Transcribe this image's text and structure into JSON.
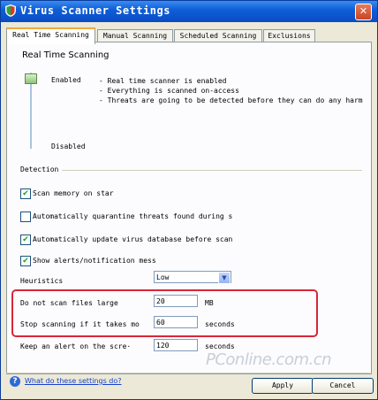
{
  "window": {
    "title": "Virus Scanner Settings"
  },
  "tabs": [
    {
      "label": "Real Time Scanning",
      "active": true
    },
    {
      "label": "Manual Scanning",
      "active": false
    },
    {
      "label": "Scheduled Scanning",
      "active": false
    },
    {
      "label": "Exclusions",
      "active": false
    }
  ],
  "realtime": {
    "heading": "Real Time Scanning",
    "enabled_label": "Enabled",
    "disabled_label": "Disabled",
    "descriptions": [
      "- Real time scanner is enabled",
      "- Everything is scanned on-access",
      "- Threats are going to be detected before they can do any harm"
    ]
  },
  "detection": {
    "label": "Detection",
    "options": [
      {
        "label": "Scan memory on star",
        "checked": true
      },
      {
        "label": "Automatically quarantine threats found during s",
        "checked": false
      },
      {
        "label": "Automatically update virus database before scan",
        "checked": true
      },
      {
        "label": "Show alerts/notification mess",
        "checked": true
      }
    ]
  },
  "heuristics": {
    "label": "Heuristics",
    "value": "Low"
  },
  "limits": {
    "large_files": {
      "label": "Do not scan files large",
      "value": "20",
      "unit": "MB"
    },
    "stop_scanning": {
      "label": "Stop scanning if it takes mo",
      "value": "60",
      "unit": "seconds"
    },
    "alert_screen": {
      "label": "Keep an alert on the scre·",
      "value": "120",
      "unit": "seconds"
    }
  },
  "footer": {
    "help_link": "What do these settings do?",
    "apply_label": "Apply",
    "cancel_label": "Cancel"
  },
  "watermark": "PConline.com.cn",
  "colors": {
    "titlebar": "#0a4cc4",
    "highlight": "#d8263a",
    "checkmark": "#21a121"
  }
}
